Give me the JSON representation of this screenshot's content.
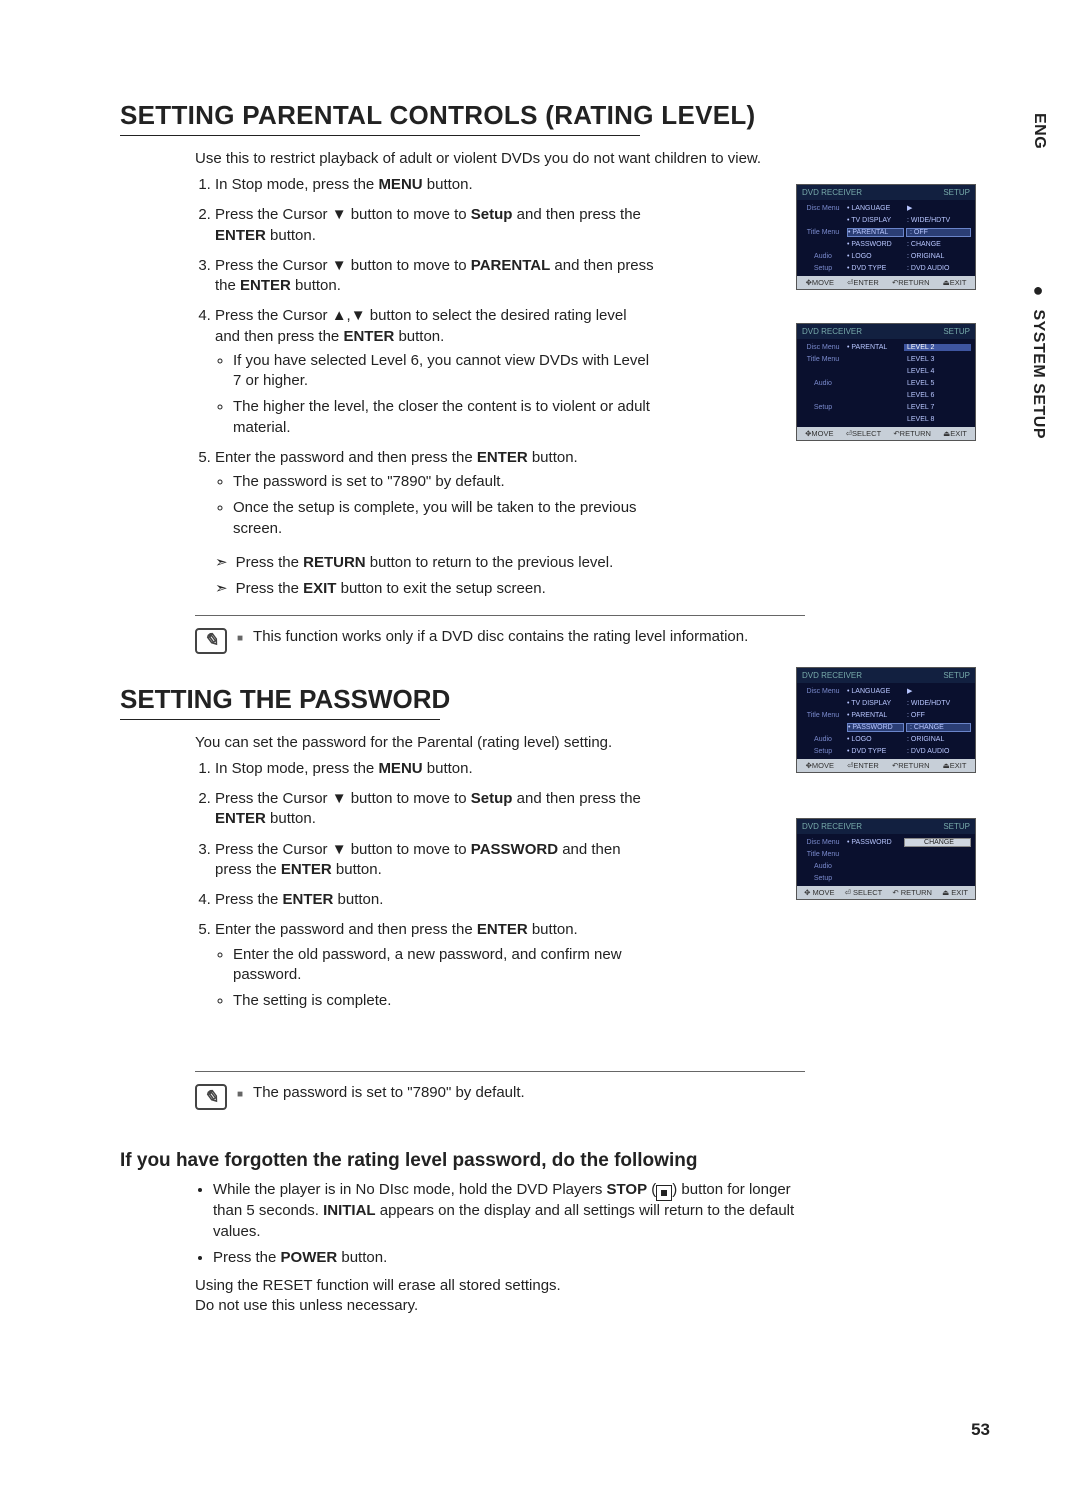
{
  "side_lang": "ENG",
  "side_section": "SYSTEM SETUP",
  "page_number": "53",
  "section1": {
    "title": "SETTING PARENTAL CONTROLS (RATING LEVEL)",
    "intro": "Use this to restrict playback of adult or violent DVDs you do not want children to view.",
    "step1_a": "In Stop mode, press the ",
    "step1_b": "MENU",
    "step1_c": " button.",
    "step2_a": "Press the Cursor ▼ button to move to ",
    "step2_b": "Setup",
    "step2_c": " and then press the ",
    "step2_d": "ENTER",
    "step2_e": " button.",
    "step3_a": "Press the Cursor ▼ button to move to ",
    "step3_b": "PARENTAL",
    "step3_c": " and then press the ",
    "step3_d": "ENTER",
    "step3_e": " button.",
    "step4_a": "Press the Cursor ▲,▼ button to select the desired rating level and then press the ",
    "step4_b": "ENTER",
    "step4_c": " button.",
    "step4_bul1": "If you have selected Level 6, you cannot view DVDs with Level 7 or higher.",
    "step4_bul2": "The higher the level, the closer the content is to violent or adult material.",
    "step5_a": "Enter the password and then press the ",
    "step5_b": "ENTER",
    "step5_c": " button.",
    "step5_bul1": "The password is set to \"7890\" by default.",
    "step5_bul2": "Once the setup is complete, you will be taken to the previous screen.",
    "arrow1_a": "Press the ",
    "arrow1_b": "RETURN",
    "arrow1_c": " button to return to the previous level.",
    "arrow2_a": "Press the ",
    "arrow2_b": "EXIT",
    "arrow2_c": " button to exit the setup screen.",
    "note": "This function works only if a DVD disc contains the rating level information."
  },
  "section2": {
    "title": "SETTING THE PASSWORD",
    "intro": "You can set the password for the Parental (rating level) setting.",
    "step1_a": "In Stop mode, press the ",
    "step1_b": "MENU",
    "step1_c": " button.",
    "step2_a": "Press the Cursor ▼ button to move to ",
    "step2_b": "Setup",
    "step2_c": " and then press the ",
    "step2_d": "ENTER",
    "step2_e": " button.",
    "step3_a": "Press the Cursor ▼ button to move to ",
    "step3_b": "PASSWORD",
    "step3_c": " and then press the ",
    "step3_d": "ENTER",
    "step3_e": " button.",
    "step4_a": "Press the ",
    "step4_b": "ENTER",
    "step4_c": " button.",
    "step5_a": "Enter the password and then press the ",
    "step5_b": "ENTER",
    "step5_c": " button.",
    "step5_bul1": "Enter the old password, a new password, and confirm new password.",
    "step5_bul2": "The setting is complete.",
    "note": "The password is set to \"7890\" by default."
  },
  "section3": {
    "title": "If you have forgotten the rating level password, do the following",
    "b1_a": "While the player is in No DIsc mode, hold the DVD Players ",
    "b1_b": "STOP",
    "b1_c": " (",
    "b1_d": ") button for longer than 5 seconds. ",
    "b1_e": "INITIAL",
    "b1_f": " appears on the display and all settings will return to the default values.",
    "b2_a": "Press the ",
    "b2_b": "POWER",
    "b2_c": " button.",
    "p1": "Using the RESET function will erase all stored settings.",
    "p2": "Do not use this unless necessary."
  },
  "osd": {
    "title_left": "DVD RECEIVER",
    "title_right": "SETUP",
    "sidebar": [
      "Disc Menu",
      "Title Menu",
      "Audio",
      "Setup"
    ],
    "items": {
      "language": "• LANGUAGE",
      "tv_display": "• TV DISPLAY",
      "parental": "• PARENTAL",
      "password": "• PASSWORD",
      "logo": "• LOGO",
      "dvd_type": "• DVD TYPE"
    },
    "values": {
      "wide_hdtv": ": WIDE/HDTV",
      "off": ": OFF",
      "change": ": CHANGE",
      "original": ": ORIGINAL",
      "dvd_audio": ": DVD AUDIO"
    },
    "levels": [
      "LEVEL 2",
      "LEVEL 3",
      "LEVEL 4",
      "LEVEL 5",
      "LEVEL 6",
      "LEVEL 7",
      "LEVEL 8"
    ],
    "footer": {
      "move": "MOVE",
      "enter": "ENTER",
      "select": "SELECT",
      "return": "RETURN",
      "exit": "EXIT"
    },
    "change_box": "CHANGE"
  }
}
